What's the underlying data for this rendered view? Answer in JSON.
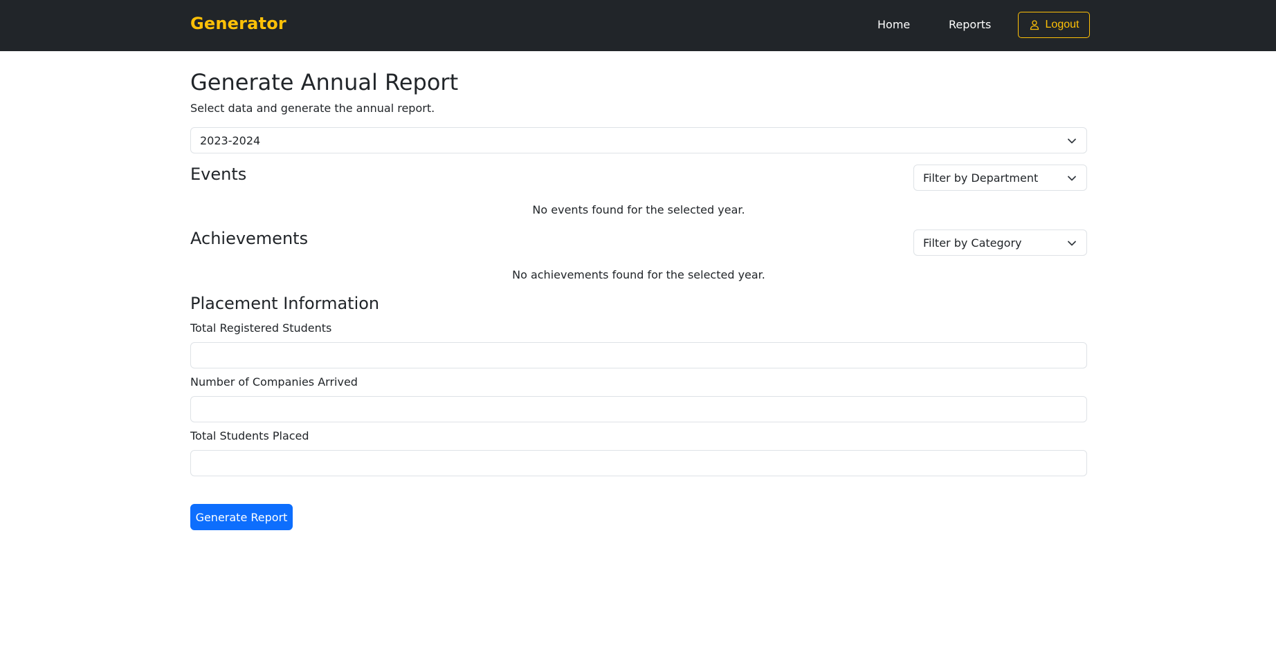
{
  "navbar": {
    "brand": "Generator",
    "links": [
      {
        "label": "Home"
      },
      {
        "label": "Reports"
      }
    ],
    "logout_label": "Logout",
    "logout_icon": "user-icon"
  },
  "header": {
    "title": "Generate Annual Report",
    "subtitle": "Select data and generate the annual report."
  },
  "year_select": {
    "value": "2023-2024",
    "icon": "chevron-down-icon"
  },
  "events": {
    "title": "Events",
    "filter_label": "Filter by Department",
    "empty_message": "No events found for the selected year."
  },
  "achievements": {
    "title": "Achievements",
    "filter_label": "Filter by Category",
    "empty_message": "No achievements found for the selected year."
  },
  "placement": {
    "title": "Placement Information",
    "fields": [
      {
        "label": "Total Registered Students",
        "value": ""
      },
      {
        "label": "Number of Companies Arrived",
        "value": ""
      },
      {
        "label": "Total Students Placed",
        "value": ""
      }
    ]
  },
  "actions": {
    "generate_label": "Generate Report"
  },
  "colors": {
    "navbar_bg": "#212529",
    "brand": "#ffc107",
    "primary": "#0d6efd",
    "border": "#dee2e6"
  }
}
